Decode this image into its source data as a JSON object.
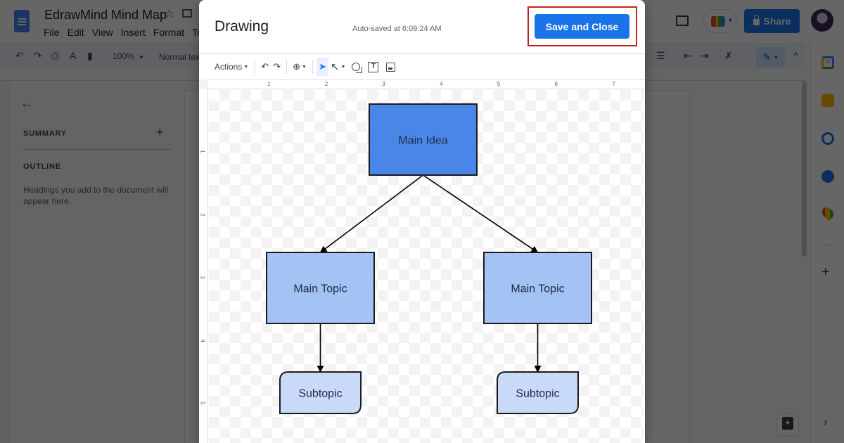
{
  "docs": {
    "title": "EdrawMind Mind Map",
    "menu": [
      "File",
      "Edit",
      "View",
      "Insert",
      "Format",
      "Too"
    ],
    "zoom": "100%",
    "style": "Normal text",
    "share_label": "Share",
    "calendar_day": "31",
    "outline_panel": {
      "summary_label": "SUMMARY",
      "outline_label": "OUTLINE",
      "hint": "Headings you add to the document will appear here."
    }
  },
  "dialog": {
    "title": "Drawing",
    "autosave": "Auto-saved at 6:09:24 AM",
    "save_close_label": "Save and Close",
    "highlight_color": "#c5221f",
    "toolbar": {
      "actions_label": "Actions",
      "tools": [
        "undo-icon",
        "redo-icon",
        "zoom-icon",
        "select-icon",
        "line-icon",
        "shape-icon",
        "textbox-icon",
        "image-icon"
      ],
      "active_tool": "select",
      "textbox_glyph": "T"
    },
    "ruler": {
      "horizontal_labels": [
        "1",
        "2",
        "3",
        "4",
        "5",
        "6",
        "7"
      ],
      "vertical_labels": [
        "1",
        "2",
        "3",
        "4",
        "5"
      ]
    },
    "diagram": {
      "nodes": [
        {
          "id": "main-idea",
          "label": "Main Idea",
          "fill": "#4a86e8",
          "shape": "rect"
        },
        {
          "id": "main-topic-left",
          "label": "Main Topic",
          "fill": "#a4c2f4",
          "shape": "rect"
        },
        {
          "id": "main-topic-right",
          "label": "Main Topic",
          "fill": "#a4c2f4",
          "shape": "rect"
        },
        {
          "id": "subtopic-left",
          "label": "Subtopic",
          "fill": "#c9daf8",
          "shape": "rounded-corner"
        },
        {
          "id": "subtopic-right",
          "label": "Subtopic",
          "fill": "#c9daf8",
          "shape": "rounded-corner"
        }
      ],
      "edges": [
        {
          "from": "main-idea",
          "to": "main-topic-left"
        },
        {
          "from": "main-idea",
          "to": "main-topic-right"
        },
        {
          "from": "main-topic-left",
          "to": "subtopic-left"
        },
        {
          "from": "main-topic-right",
          "to": "subtopic-right"
        }
      ]
    }
  }
}
